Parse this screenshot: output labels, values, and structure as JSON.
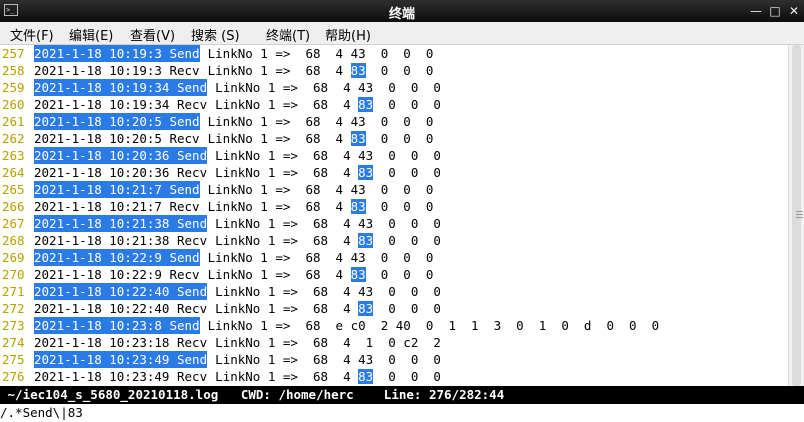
{
  "window": {
    "title": "终端"
  },
  "menu": [
    "文件(F)",
    "编辑(E)",
    "查看(V)",
    "搜索 (S)",
    "终端(T)",
    "帮助(H)"
  ],
  "lines": [
    {
      "n": "257",
      "ts": "2021-1-18 10:19:3 Send",
      "rest": " LinkNo 1 =>  68  4 43  0  0  0",
      "hl": true
    },
    {
      "n": "258",
      "ts": "2021-1-18 10:19:3 Recv",
      "rest": " LinkNo 1 =>  68  4 ",
      "m": "83",
      "after": "  0  0  0",
      "hl": false
    },
    {
      "n": "259",
      "ts": "2021-1-18 10:19:34 Send",
      "rest": " LinkNo 1 =>  68  4 43  0  0  0",
      "hl": true
    },
    {
      "n": "260",
      "ts": "2021-1-18 10:19:34 Recv",
      "rest": " LinkNo 1 =>  68  4 ",
      "m": "83",
      "after": "  0  0  0",
      "hl": false
    },
    {
      "n": "261",
      "ts": "2021-1-18 10:20:5 Send",
      "rest": " LinkNo 1 =>  68  4 43  0  0  0",
      "hl": true
    },
    {
      "n": "262",
      "ts": "2021-1-18 10:20:5 Recv",
      "rest": " LinkNo 1 =>  68  4 ",
      "m": "83",
      "after": "  0  0  0",
      "hl": false
    },
    {
      "n": "263",
      "ts": "2021-1-18 10:20:36 Send",
      "rest": " LinkNo 1 =>  68  4 43  0  0  0",
      "hl": true
    },
    {
      "n": "264",
      "ts": "2021-1-18 10:20:36 Recv",
      "rest": " LinkNo 1 =>  68  4 ",
      "m": "83",
      "after": "  0  0  0",
      "hl": false
    },
    {
      "n": "265",
      "ts": "2021-1-18 10:21:7 Send",
      "rest": " LinkNo 1 =>  68  4 43  0  0  0",
      "hl": true
    },
    {
      "n": "266",
      "ts": "2021-1-18 10:21:7 Recv",
      "rest": " LinkNo 1 =>  68  4 ",
      "m": "83",
      "after": "  0  0  0",
      "hl": false
    },
    {
      "n": "267",
      "ts": "2021-1-18 10:21:38 Send",
      "rest": " LinkNo 1 =>  68  4 43  0  0  0",
      "hl": true
    },
    {
      "n": "268",
      "ts": "2021-1-18 10:21:38 Recv",
      "rest": " LinkNo 1 =>  68  4 ",
      "m": "83",
      "after": "  0  0  0",
      "hl": false
    },
    {
      "n": "269",
      "ts": "2021-1-18 10:22:9 Send",
      "rest": " LinkNo 1 =>  68  4 43  0  0  0",
      "hl": true
    },
    {
      "n": "270",
      "ts": "2021-1-18 10:22:9 Recv",
      "rest": " LinkNo 1 =>  68  4 ",
      "m": "83",
      "after": "  0  0  0",
      "hl": false
    },
    {
      "n": "271",
      "ts": "2021-1-18 10:22:40 Send",
      "rest": " LinkNo 1 =>  68  4 43  0  0  0",
      "hl": true
    },
    {
      "n": "272",
      "ts": "2021-1-18 10:22:40 Recv",
      "rest": " LinkNo 1 =>  68  4 ",
      "m": "83",
      "after": "  0  0  0",
      "hl": false
    },
    {
      "n": "273",
      "ts": "2021-1-18 10:23:8 Send",
      "rest": " LinkNo 1 =>  68  e c0  2 40  0  1  1  3  0  1  0  d  0  0  0",
      "hl": true
    },
    {
      "n": "274",
      "ts": "2021-1-18 10:23:18 Recv",
      "rest": " LinkNo 1 =>  68  4  1  0 c2  2",
      "hl": false
    },
    {
      "n": "275",
      "ts": "2021-1-18 10:23:49 Send",
      "rest": " LinkNo 1 =>  68  4 43  0  0  0",
      "hl": true
    },
    {
      "n": "276",
      "ts": "2021-1-18 10:23:49 Recv",
      "rest": " LinkNo 1 =>  68  4 ",
      "m": "83",
      "after": "  0  0  0",
      "hl": false
    }
  ],
  "status": " ~/iec104_s_5680_20210118.log   CWD: /home/herc    Line: 276/282:44",
  "command": "/.*Send\\|83",
  "colors": {
    "highlight": "#2b7be6",
    "line_number": "#b5a100",
    "titlebar": "#1a1a1a"
  }
}
